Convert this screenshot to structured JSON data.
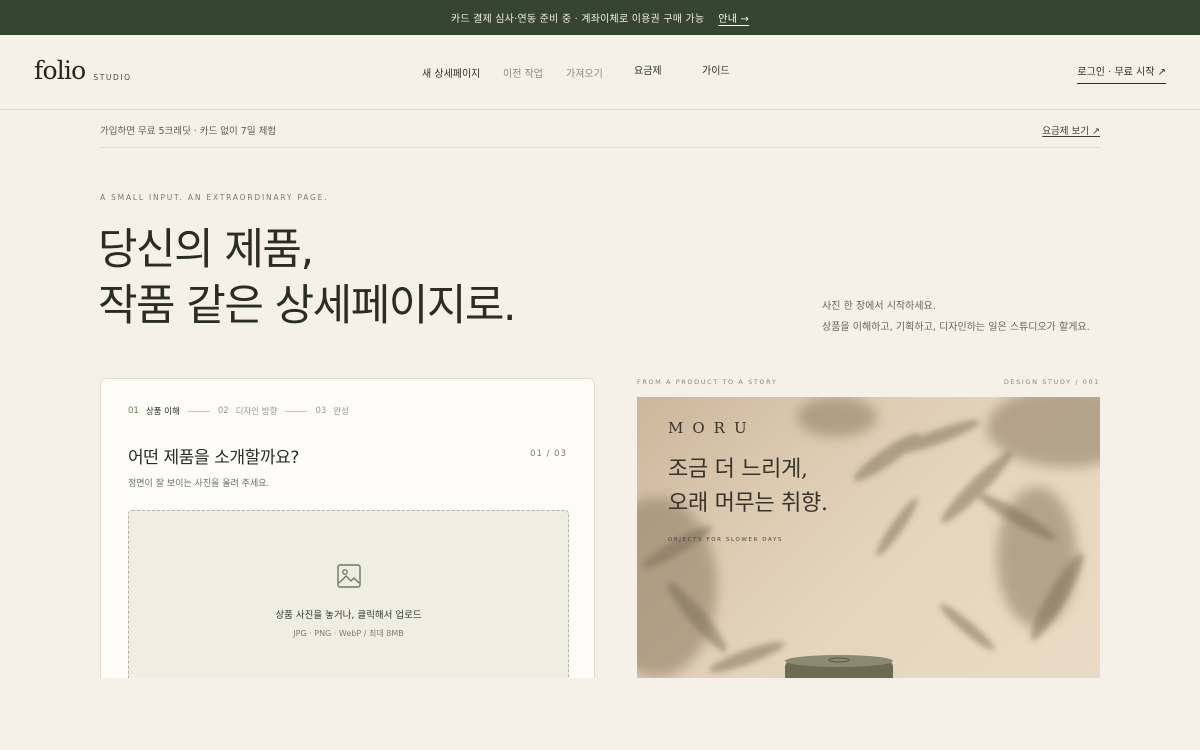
{
  "announcement": {
    "text": "카드 결제 심사·연동 준비 중 · 계좌이체로 이용권 구매 가능",
    "link": "안내 →"
  },
  "brand": {
    "name": "folio",
    "sub": "STUDIO"
  },
  "nav": {
    "items": [
      {
        "label": "새 상세페이지",
        "state": "active"
      },
      {
        "label": "이전 작업",
        "state": "muted"
      },
      {
        "label": "가져오기",
        "state": "muted"
      },
      {
        "label": "요금제",
        "state": "normal"
      },
      {
        "label": "가이드",
        "state": "normal"
      }
    ],
    "login": "로그인 · 무료 시작 ↗"
  },
  "subbar": {
    "promo": "가입하면 무료 5크레딧 · 카드 없이 7일 체험",
    "pricing_link": "요금제 보기 ↗"
  },
  "hero": {
    "eyebrow": "A SMALL INPUT. AN EXTRAORDINARY PAGE.",
    "headline_line1": "당신의 제품,",
    "headline_line2": "작품 같은 상세페이지로.",
    "desc_line1": "사진 한 장에서 시작하세요.",
    "desc_line2": "상품을 이해하고, 기획하고, 디자인하는 일은 스튜디오가 할게요."
  },
  "wizard": {
    "steps": [
      {
        "num": "01",
        "label": "상품 이해",
        "active": true
      },
      {
        "num": "02",
        "label": "디자인 방향",
        "active": false
      },
      {
        "num": "03",
        "label": "완성",
        "active": false
      }
    ],
    "title": "어떤 제품을 소개할까요?",
    "page": "01 / 03",
    "hint": "정면이 잘 보이는 사진을 올려 주세요.",
    "upload": {
      "icon": "image-icon",
      "title": "상품 사진을 놓거나, 클릭해서 업로드",
      "formats": "JPG · PNG · WebP / 최대 8MB"
    }
  },
  "preview": {
    "label_left": "FROM A PRODUCT TO A STORY",
    "label_right": "DESIGN STUDY / 001",
    "brand": "MORU",
    "tagline_line1": "조금 더 느리게,",
    "tagline_line2": "오래 머무는 취향.",
    "tag_sub": "OBJECTS FOR SLOWER DAYS"
  },
  "colors": {
    "background": "#f5f1e8",
    "announcement_bg": "#35452f",
    "text_dark": "#2c2f28",
    "accent_green": "#6a7a55",
    "upload_bg": "#eeeee3"
  }
}
